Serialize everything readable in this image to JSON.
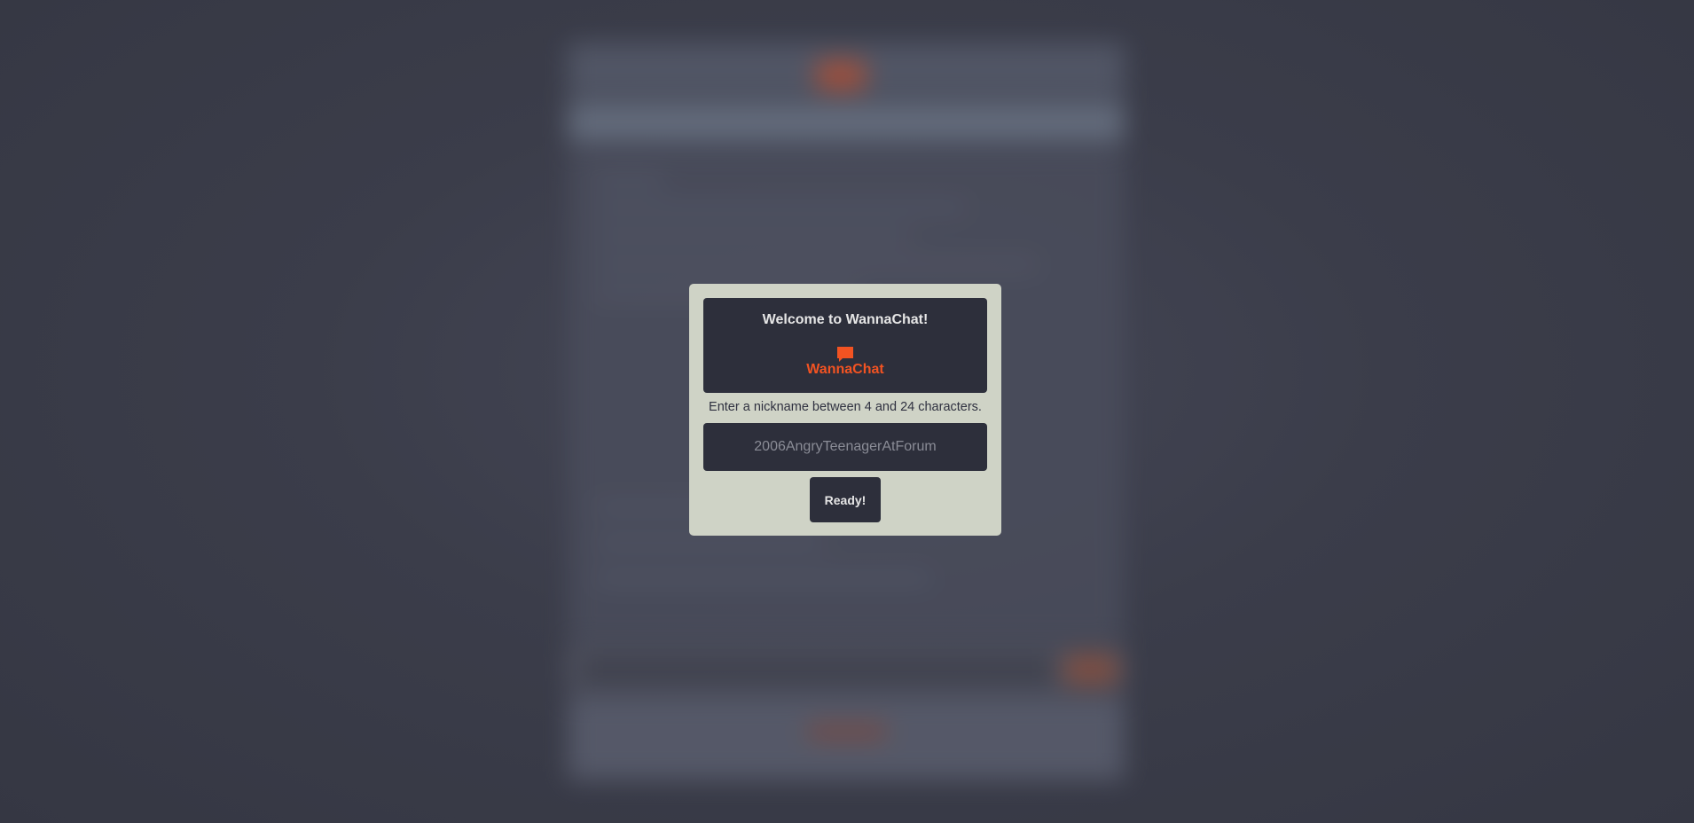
{
  "modal": {
    "title": "Welcome to WannaChat!",
    "brand_name": "WannaChat",
    "instructions": "Enter a nickname between 4 and 24 characters.",
    "nickname_placeholder": "2006AngryTeenagerAtForum",
    "ready_label": "Ready!"
  },
  "icons": {
    "brand": "chat-bubble-icon"
  },
  "colors": {
    "accent": "#f25322",
    "modal_background": "#cfd3c6",
    "card_background": "#2d2f3b",
    "page_background": "#3a3c48"
  }
}
